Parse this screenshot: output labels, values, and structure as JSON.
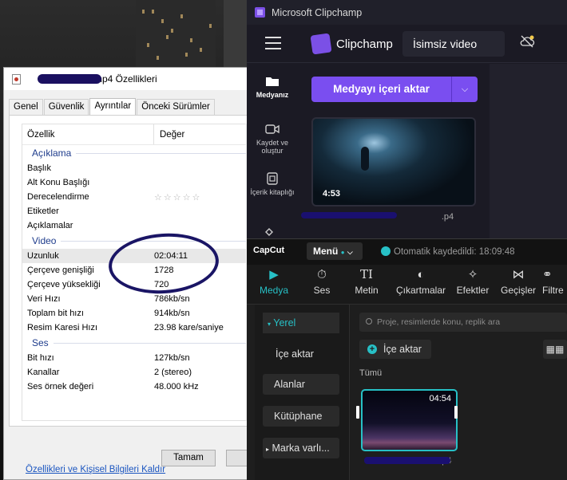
{
  "properties_dialog": {
    "title": "mp4 Özellikleri",
    "tabs": [
      "Genel",
      "Güvenlik",
      "Ayrıntılar",
      "Önceki Sürümler"
    ],
    "active_tab": "Ayrıntılar",
    "columns": {
      "property": "Özellik",
      "value": "Değer"
    },
    "sections": {
      "description": "Açıklama",
      "video": "Video",
      "audio": "Ses"
    },
    "description_rows": [
      "Başlık",
      "Alt Konu Başlığı",
      "Derecelendirme",
      "Etiketler",
      "Açıklamalar"
    ],
    "rating_stars": "☆☆☆☆☆",
    "video_rows": [
      {
        "name": "Uzunluk",
        "value": "02:04:11"
      },
      {
        "name": "Çerçeve genişliği",
        "value": "1728"
      },
      {
        "name": "Çerçeve yüksekliği",
        "value": "720"
      },
      {
        "name": "Veri Hızı",
        "value": "786kb/sn"
      },
      {
        "name": "Toplam bit hızı",
        "value": "914kb/sn"
      },
      {
        "name": "Resim Karesi Hızı",
        "value": "23.98 kare/saniye"
      }
    ],
    "audio_rows": [
      {
        "name": "Bit hızı",
        "value": "127kb/sn"
      },
      {
        "name": "Kanallar",
        "value": "2 (stereo)"
      },
      {
        "name": "Ses örnek değeri",
        "value": "48.000 kHz"
      }
    ],
    "remove_link": "Özellikleri ve Kişisel Bilgileri Kaldır",
    "ok_button": "Tamam"
  },
  "clipchamp": {
    "window_title": "Microsoft Clipchamp",
    "brand": "Clipchamp",
    "project_name": "İsimsiz video",
    "sidebar": [
      {
        "label": "Medyanız",
        "icon": "folder-icon"
      },
      {
        "label": "Kaydet ve oluştur",
        "icon": "record-icon"
      },
      {
        "label": "İçerik kitaplığı",
        "icon": "library-icon"
      }
    ],
    "import_button": "Medyayı içeri aktar",
    "media_duration": "4:53",
    "media_file_suffix": ".p4",
    "accent": "#7a4ef0"
  },
  "capcut": {
    "logo": "CapCut",
    "menu_label": "Menü",
    "autosave": "Otomatik kaydedildi: 18:09:48",
    "tabs": [
      {
        "label": "Medya",
        "icon": "media-icon"
      },
      {
        "label": "Ses",
        "icon": "audio-icon"
      },
      {
        "label": "Metin",
        "icon": "text-icon"
      },
      {
        "label": "Çıkartmalar",
        "icon": "sticker-icon"
      },
      {
        "label": "Efektler",
        "icon": "effects-icon"
      },
      {
        "label": "Geçişler",
        "icon": "transitions-icon"
      },
      {
        "label": "Filtre",
        "icon": "filter-icon"
      }
    ],
    "left_nav": [
      "Yerel",
      "İçe aktar",
      "Alanlar",
      "Kütüphane",
      "Marka varlı..."
    ],
    "search_placeholder": "Proje, resimlerde konu, replik ara",
    "import_button": "İçe aktar",
    "filter_all": "Tümü",
    "clip_duration": "04:54",
    "clip_name_suffix": ".mp4",
    "accent": "#27c0c6"
  }
}
